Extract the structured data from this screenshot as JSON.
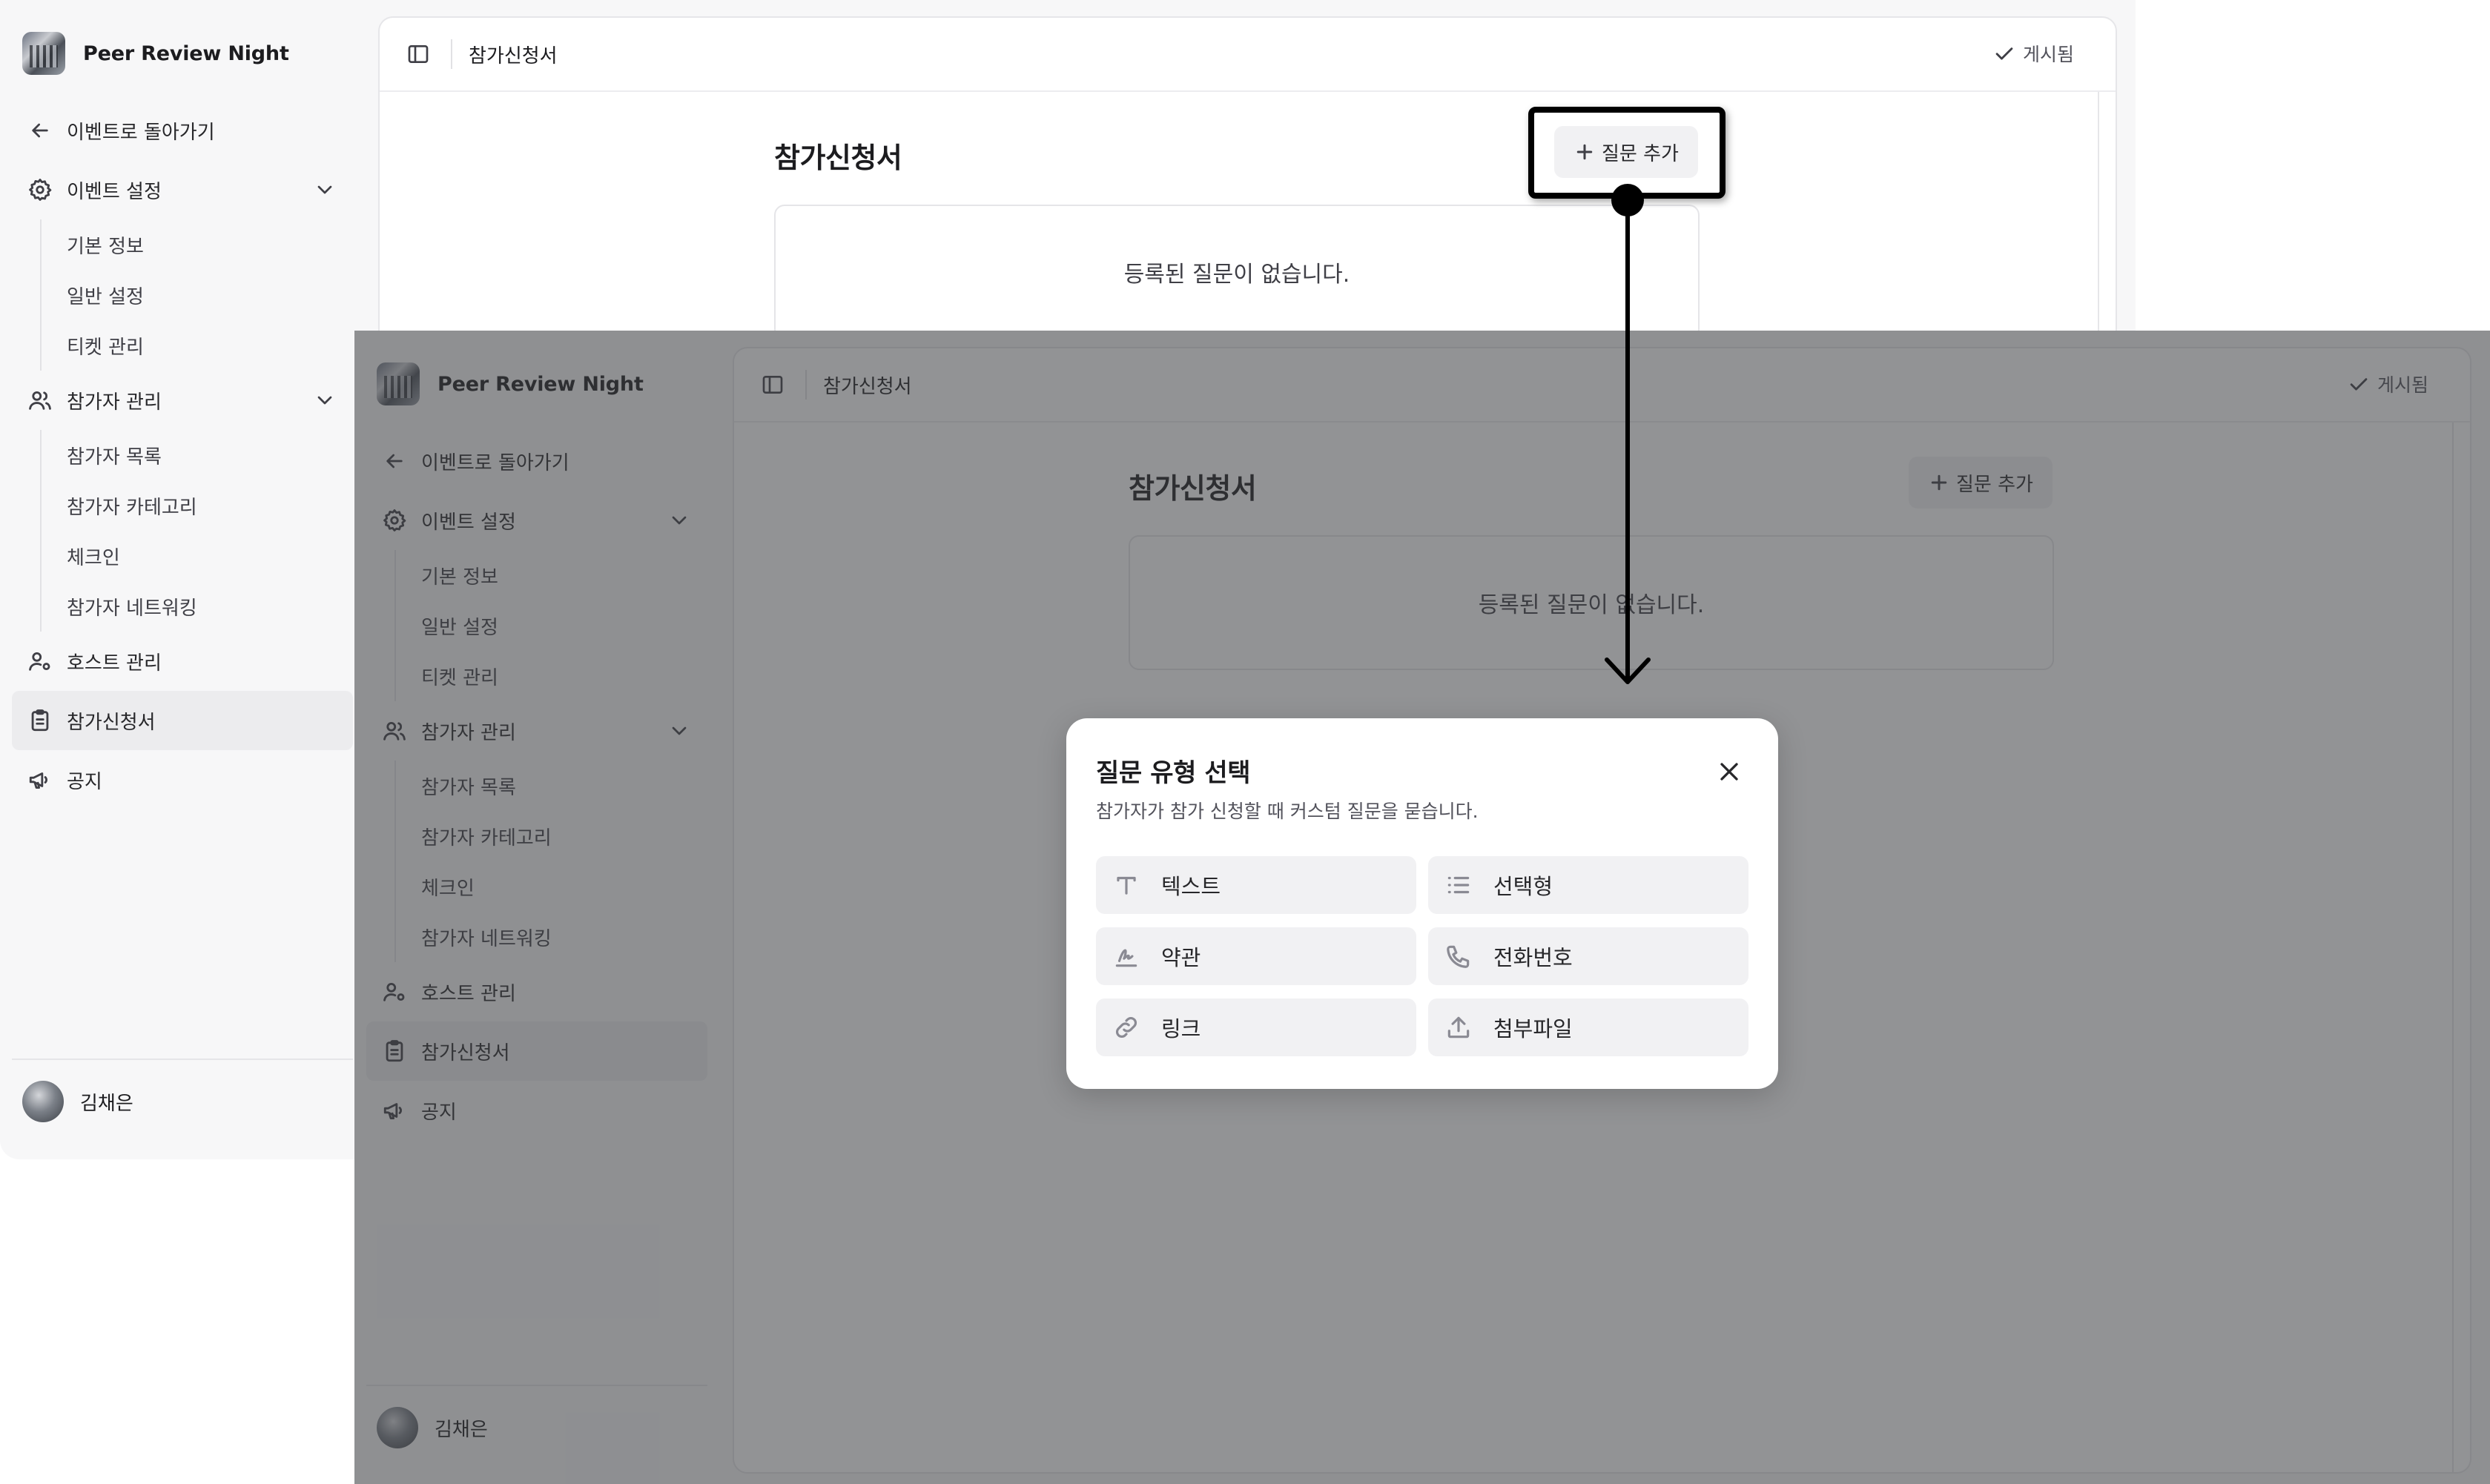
{
  "app": {
    "event_name": "Peer Review Night",
    "back_link": "이벤트로 돌아가기",
    "user_name": "김채은"
  },
  "sidebar": {
    "event_settings": {
      "label": "이벤트 설정",
      "items": [
        "기본 정보",
        "일반 설정",
        "티켓 관리"
      ]
    },
    "participant_mgmt": {
      "label": "참가자 관리",
      "items": [
        "참가자 목록",
        "참가자 카테고리",
        "체크인",
        "참가자 네트워킹"
      ]
    },
    "host_mgmt": "호스트 관리",
    "application_form": "참가신청서",
    "notice": "공지"
  },
  "header": {
    "breadcrumb": "참가신청서",
    "status": "게시됨"
  },
  "content": {
    "title": "참가신청서",
    "add_question": "질문 추가",
    "empty_message": "등록된 질문이 없습니다."
  },
  "modal": {
    "title": "질문 유형 선택",
    "description": "참가자가 참가 신청할 때 커스텀 질문을 묻습니다.",
    "options": [
      {
        "label": "텍스트",
        "icon": "text-type-icon"
      },
      {
        "label": "선택형",
        "icon": "list-icon"
      },
      {
        "label": "약관",
        "icon": "signature-icon"
      },
      {
        "label": "전화번호",
        "icon": "phone-icon"
      },
      {
        "label": "링크",
        "icon": "link-icon"
      },
      {
        "label": "첨부파일",
        "icon": "upload-icon"
      }
    ]
  }
}
